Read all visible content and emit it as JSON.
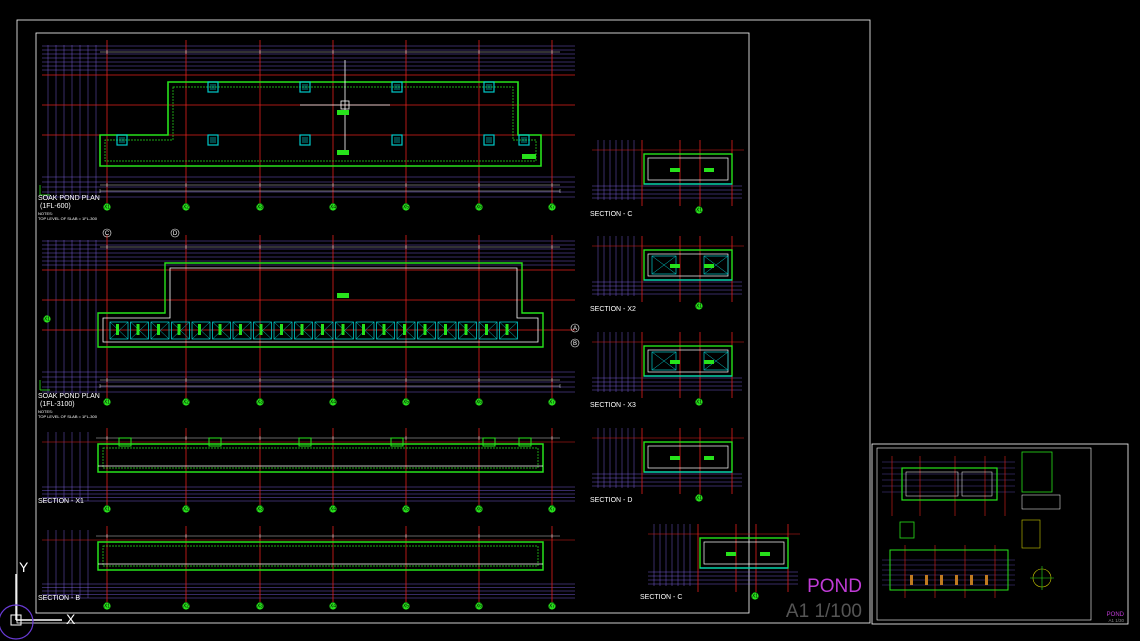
{
  "colors": {
    "background": "#000000",
    "frame": "#ffffff",
    "grid_line": "#e0201c",
    "dim_line": "#8a6cff",
    "wall": "#27e21b",
    "column": "#00c8c8",
    "tag_fill": "#27e21b",
    "title_magenta": "#c03bd6",
    "white": "#ffffff"
  },
  "sheet_main": {
    "title": "POND",
    "scale": "A1 1/100"
  },
  "sheet_thumb": {
    "title": "POND",
    "scale": "A1 1/30"
  },
  "plans": [
    {
      "title": "SOAK POND PLAN",
      "subtitle": "(1FL-600)",
      "note_label": "NOTES:",
      "note": "TOP LEVEL OF SLAB = 1FL-300"
    },
    {
      "title": "SOAK POND PLAN",
      "subtitle": "(1FL-3100)",
      "note_label": "NOTES:",
      "note": "TOP LEVEL OF SLAB = 1FL-300"
    }
  ],
  "sections_left": [
    {
      "label": "SECTION - X1"
    },
    {
      "label": "SECTION - B"
    }
  ],
  "sections_right": [
    {
      "label": "SECTION - C"
    },
    {
      "label": "SECTION - X2"
    },
    {
      "label": "SECTION - X3"
    },
    {
      "label": "SECTION - D"
    },
    {
      "label": "SECTION - C"
    }
  ],
  "grid_bubbles": [
    "X1",
    "X2",
    "X3",
    "X4",
    "X5",
    "X6",
    "X7",
    "X8"
  ],
  "section_markers": [
    "A",
    "B",
    "C",
    "D"
  ],
  "ucs_icon": {
    "y_label": "Y",
    "x_label": "X"
  }
}
